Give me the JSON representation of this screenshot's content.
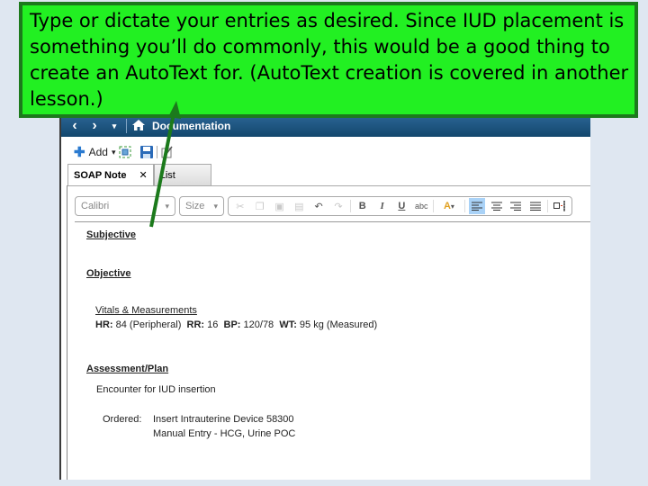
{
  "callout": {
    "text": "Type or dictate your entries as desired.  Since IUD placement is something you’ll do commonly, this would be a good thing to create an AutoText for.  (AutoText creation is covered in another lesson.)"
  },
  "nav": {
    "back_icon": "‹",
    "forward_icon": "›",
    "dropdown_icon": "▾",
    "home_icon": "⌂",
    "title": "Documentation"
  },
  "toolbar": {
    "add_label": "Add",
    "add_dropdown": "▾"
  },
  "tabs": [
    {
      "label": "SOAP Note",
      "close": "✕",
      "active": true
    },
    {
      "label": "List",
      "active": false
    }
  ],
  "format": {
    "font_value": "Calibri",
    "size_placeholder": "Size",
    "bold": "B",
    "italic": "I",
    "underline": "U",
    "strike": "abc",
    "highlight": "A"
  },
  "colors": {
    "callout_bg": "#22f022",
    "callout_border": "#1c7a1c",
    "nav_bg": "#1d557f",
    "align_selected": "#a9d2f7"
  },
  "document": {
    "subjective": "Subjective",
    "objective": "Objective",
    "vitals_heading": "Vitals & Measurements",
    "vitals": [
      {
        "label": "HR:",
        "value": "84 (Peripheral)"
      },
      {
        "label": "RR:",
        "value": "16"
      },
      {
        "label": "BP:",
        "value": "120/78"
      },
      {
        "label": "WT:",
        "value": "95 kg (Measured)"
      }
    ],
    "assessment": "Assessment/Plan",
    "encounter": "Encounter for IUD insertion",
    "ordered_label": "Ordered:",
    "orders": [
      "Insert Intrauterine Device 58300",
      "Manual Entry - HCG, Urine POC"
    ]
  }
}
